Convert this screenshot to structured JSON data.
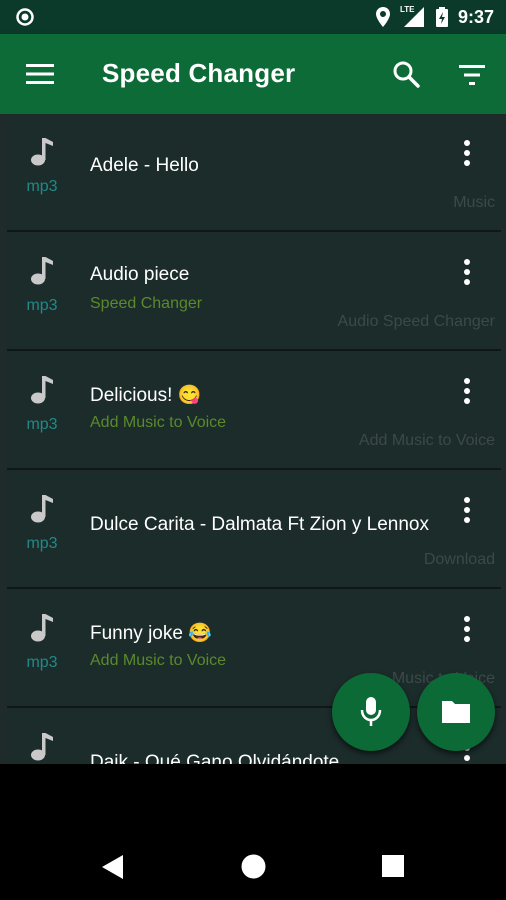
{
  "status": {
    "time": "9:37",
    "network": "LTE"
  },
  "app_bar": {
    "title": "Speed Changer"
  },
  "items": [
    {
      "title": "Adele - Hello",
      "subtitle": "",
      "ext": "mp3",
      "source": "Music"
    },
    {
      "title": "Audio piece",
      "subtitle": "Speed Changer",
      "ext": "mp3",
      "source": "Audio Speed Changer"
    },
    {
      "title": "Delicious! 😋",
      "subtitle": "Add Music to Voice",
      "ext": "mp3",
      "source": "Add Music to Voice"
    },
    {
      "title": "Dulce Carita - Dalmata Ft Zion y Lennox",
      "subtitle": "",
      "ext": "mp3",
      "source": "Download"
    },
    {
      "title": "Funny joke 😂",
      "subtitle": "Add Music to Voice",
      "ext": "mp3",
      "source": "Music to Voice"
    },
    {
      "title": "Daik - Qué Gano Olvidándote",
      "subtitle": "",
      "ext": "",
      "source": ""
    }
  ],
  "colors": {
    "app_bar": "#0c6b36",
    "status_bar": "#0b3a2a",
    "list_bg": "#1c2c2b",
    "ext_text": "#1f8a88",
    "subtitle_text": "#5a8a2c",
    "fab": "#0b6a36"
  },
  "icons": [
    "menu-icon",
    "search-icon",
    "filter-icon",
    "music-note-icon",
    "more-vert-icon",
    "microphone-icon",
    "folder-icon",
    "back-icon",
    "home-icon",
    "recents-icon"
  ]
}
